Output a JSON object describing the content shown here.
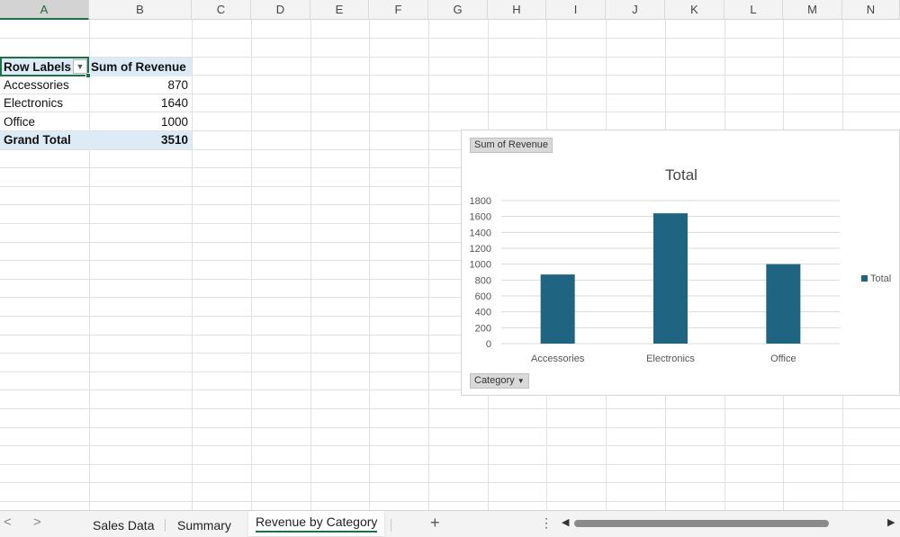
{
  "columns": [
    "A",
    "B",
    "C",
    "D",
    "E",
    "F",
    "G",
    "H",
    "I",
    "J",
    "K",
    "L",
    "M",
    "N"
  ],
  "pivot": {
    "header_row_labels": "Row Labels",
    "header_values": "Sum of Revenue",
    "rows": [
      {
        "label": "Accessories",
        "value": "870"
      },
      {
        "label": "Electronics",
        "value": "1640"
      },
      {
        "label": "Office",
        "value": "1000"
      }
    ],
    "grand_total_label": "Grand Total",
    "grand_total_value": "3510"
  },
  "chart_field_values_button": "Sum of Revenue",
  "chart_field_axis_button": "Category",
  "chart_data": {
    "type": "bar",
    "title": "Total",
    "categories": [
      "Accessories",
      "Electronics",
      "Office"
    ],
    "series": [
      {
        "name": "Total",
        "values": [
          870,
          1640,
          1000
        ],
        "color": "#1f6582"
      }
    ],
    "ylim": [
      0,
      1800
    ],
    "yticks": [
      0,
      200,
      400,
      600,
      800,
      1000,
      1200,
      1400,
      1600,
      1800
    ],
    "grid": true,
    "legend": "right"
  },
  "tabs": {
    "items": [
      "Sales Data",
      "Summary",
      "Revenue by Category"
    ],
    "active_index": 2,
    "add_symbol": "+",
    "menu_symbol": "⋮",
    "prev_symbol": "<",
    "next_symbol": ">"
  }
}
